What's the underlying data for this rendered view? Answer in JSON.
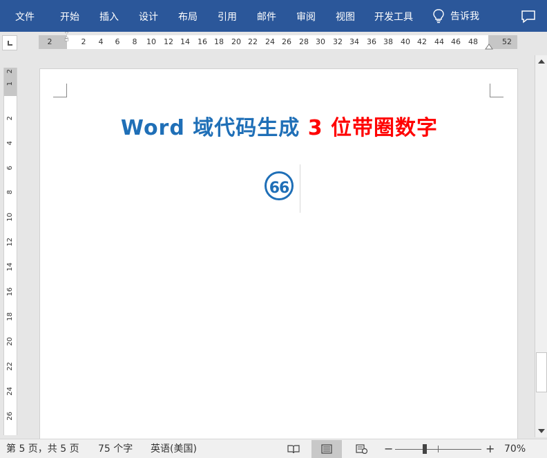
{
  "ribbon": {
    "tabs": [
      "文件",
      "开始",
      "插入",
      "设计",
      "布局",
      "引用",
      "邮件",
      "审阅",
      "视图",
      "开发工具"
    ],
    "tell_me": "告诉我"
  },
  "ruler": {
    "h_left_margin_label": "2",
    "h_numbers": [
      "2",
      "4",
      "6",
      "8",
      "10",
      "12",
      "14",
      "16",
      "18",
      "20",
      "22",
      "24",
      "26",
      "28",
      "30",
      "32",
      "34",
      "36",
      "38",
      "40",
      "42",
      "44",
      "46",
      "48"
    ],
    "h_right_label": "52",
    "v_top_labels": [
      "2",
      "1"
    ],
    "v_numbers": [
      "2",
      "4",
      "6",
      "8",
      "10",
      "12",
      "14",
      "16",
      "18",
      "20",
      "22",
      "24",
      "26"
    ]
  },
  "document": {
    "title_part1": "Word 域代码生成",
    "title_part2": "3 位带圈数字",
    "circled_number": "66"
  },
  "status": {
    "page": "第 5 页，共 5 页",
    "words": "75 个字",
    "language": "英语(美国)",
    "zoom": "70%",
    "zoom_minus": "−",
    "zoom_plus": "+"
  },
  "colors": {
    "ribbon": "#2b579a",
    "title_blue": "#1f6fb7",
    "title_red": "#ff0000"
  }
}
